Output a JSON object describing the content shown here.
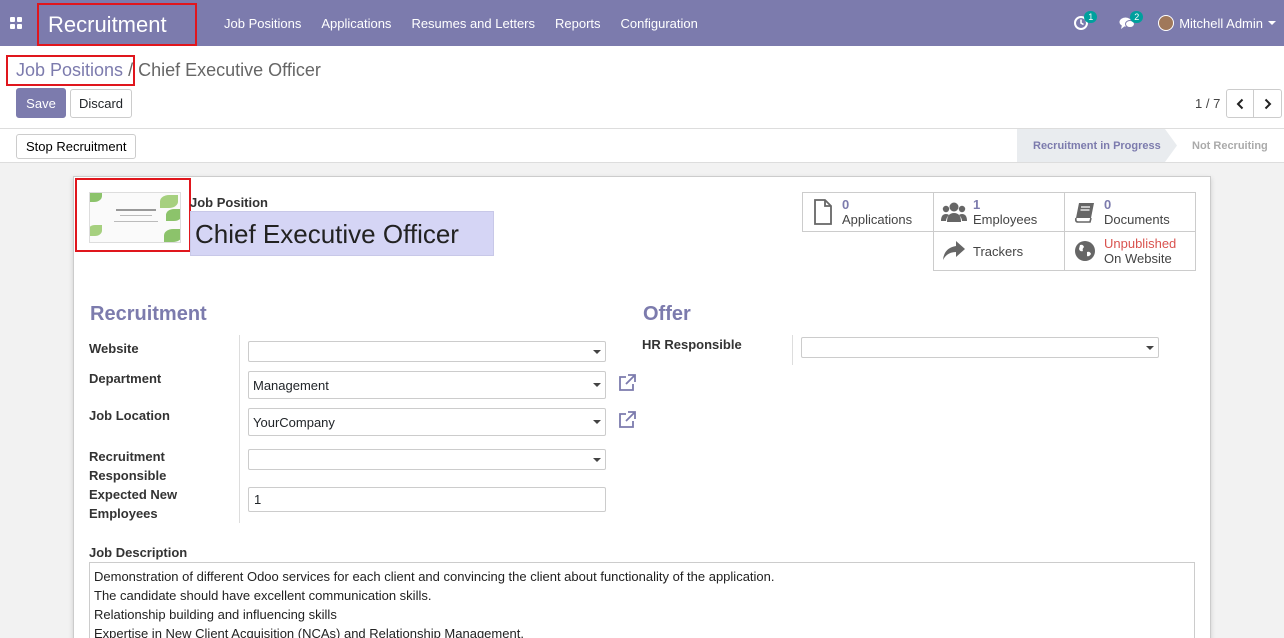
{
  "navbar": {
    "app_title": "Recruitment",
    "menu": [
      "Job Positions",
      "Applications",
      "Resumes and Letters",
      "Reports",
      "Configuration"
    ],
    "activity_count": "1",
    "message_count": "2",
    "user_name": "Mitchell Admin",
    "bg_color": "#7c7bad"
  },
  "control": {
    "breadcrumb_parent": "Job Positions",
    "breadcrumb_separator": " / ",
    "breadcrumb_current": "Chief Executive Officer",
    "save_label": "Save",
    "discard_label": "Discard",
    "pager": "1 / 7"
  },
  "statusbar": {
    "stop_label": "Stop Recruitment",
    "stage_active": "Recruitment in Progress",
    "stage_inactive": "Not Recruiting"
  },
  "form": {
    "job_position_label": "Job Position",
    "job_name": "Chief Executive Officer",
    "smart_buttons": {
      "applications": {
        "count": "0",
        "label": "Applications"
      },
      "employees": {
        "count": "1",
        "label": "Employees"
      },
      "documents": {
        "count": "0",
        "label": "Documents"
      },
      "trackers": {
        "label": "Trackers"
      },
      "website": {
        "status": "Unpublished",
        "label": "On Website"
      }
    },
    "recruitment": {
      "title": "Recruitment",
      "website_label": "Website",
      "website_value": "",
      "department_label": "Department",
      "department_value": "Management",
      "location_label": "Job Location",
      "location_value": "YourCompany",
      "responsible_label_1": "Recruitment",
      "responsible_label_2": "Responsible",
      "responsible_value": "",
      "expected_label_1": "Expected New",
      "expected_label_2": "Employees",
      "expected_value": "1"
    },
    "offer": {
      "title": "Offer",
      "hr_label": "HR Responsible",
      "hr_value": ""
    },
    "description": {
      "label": "Job Description",
      "lines": [
        "Demonstration of different Odoo services for each client and convincing the client about functionality of the application.",
        "The candidate should have excellent communication skills.",
        "Relationship building and influencing skills",
        "Expertise in New Client Acquisition (NCAs) and Relationship Management."
      ]
    }
  }
}
